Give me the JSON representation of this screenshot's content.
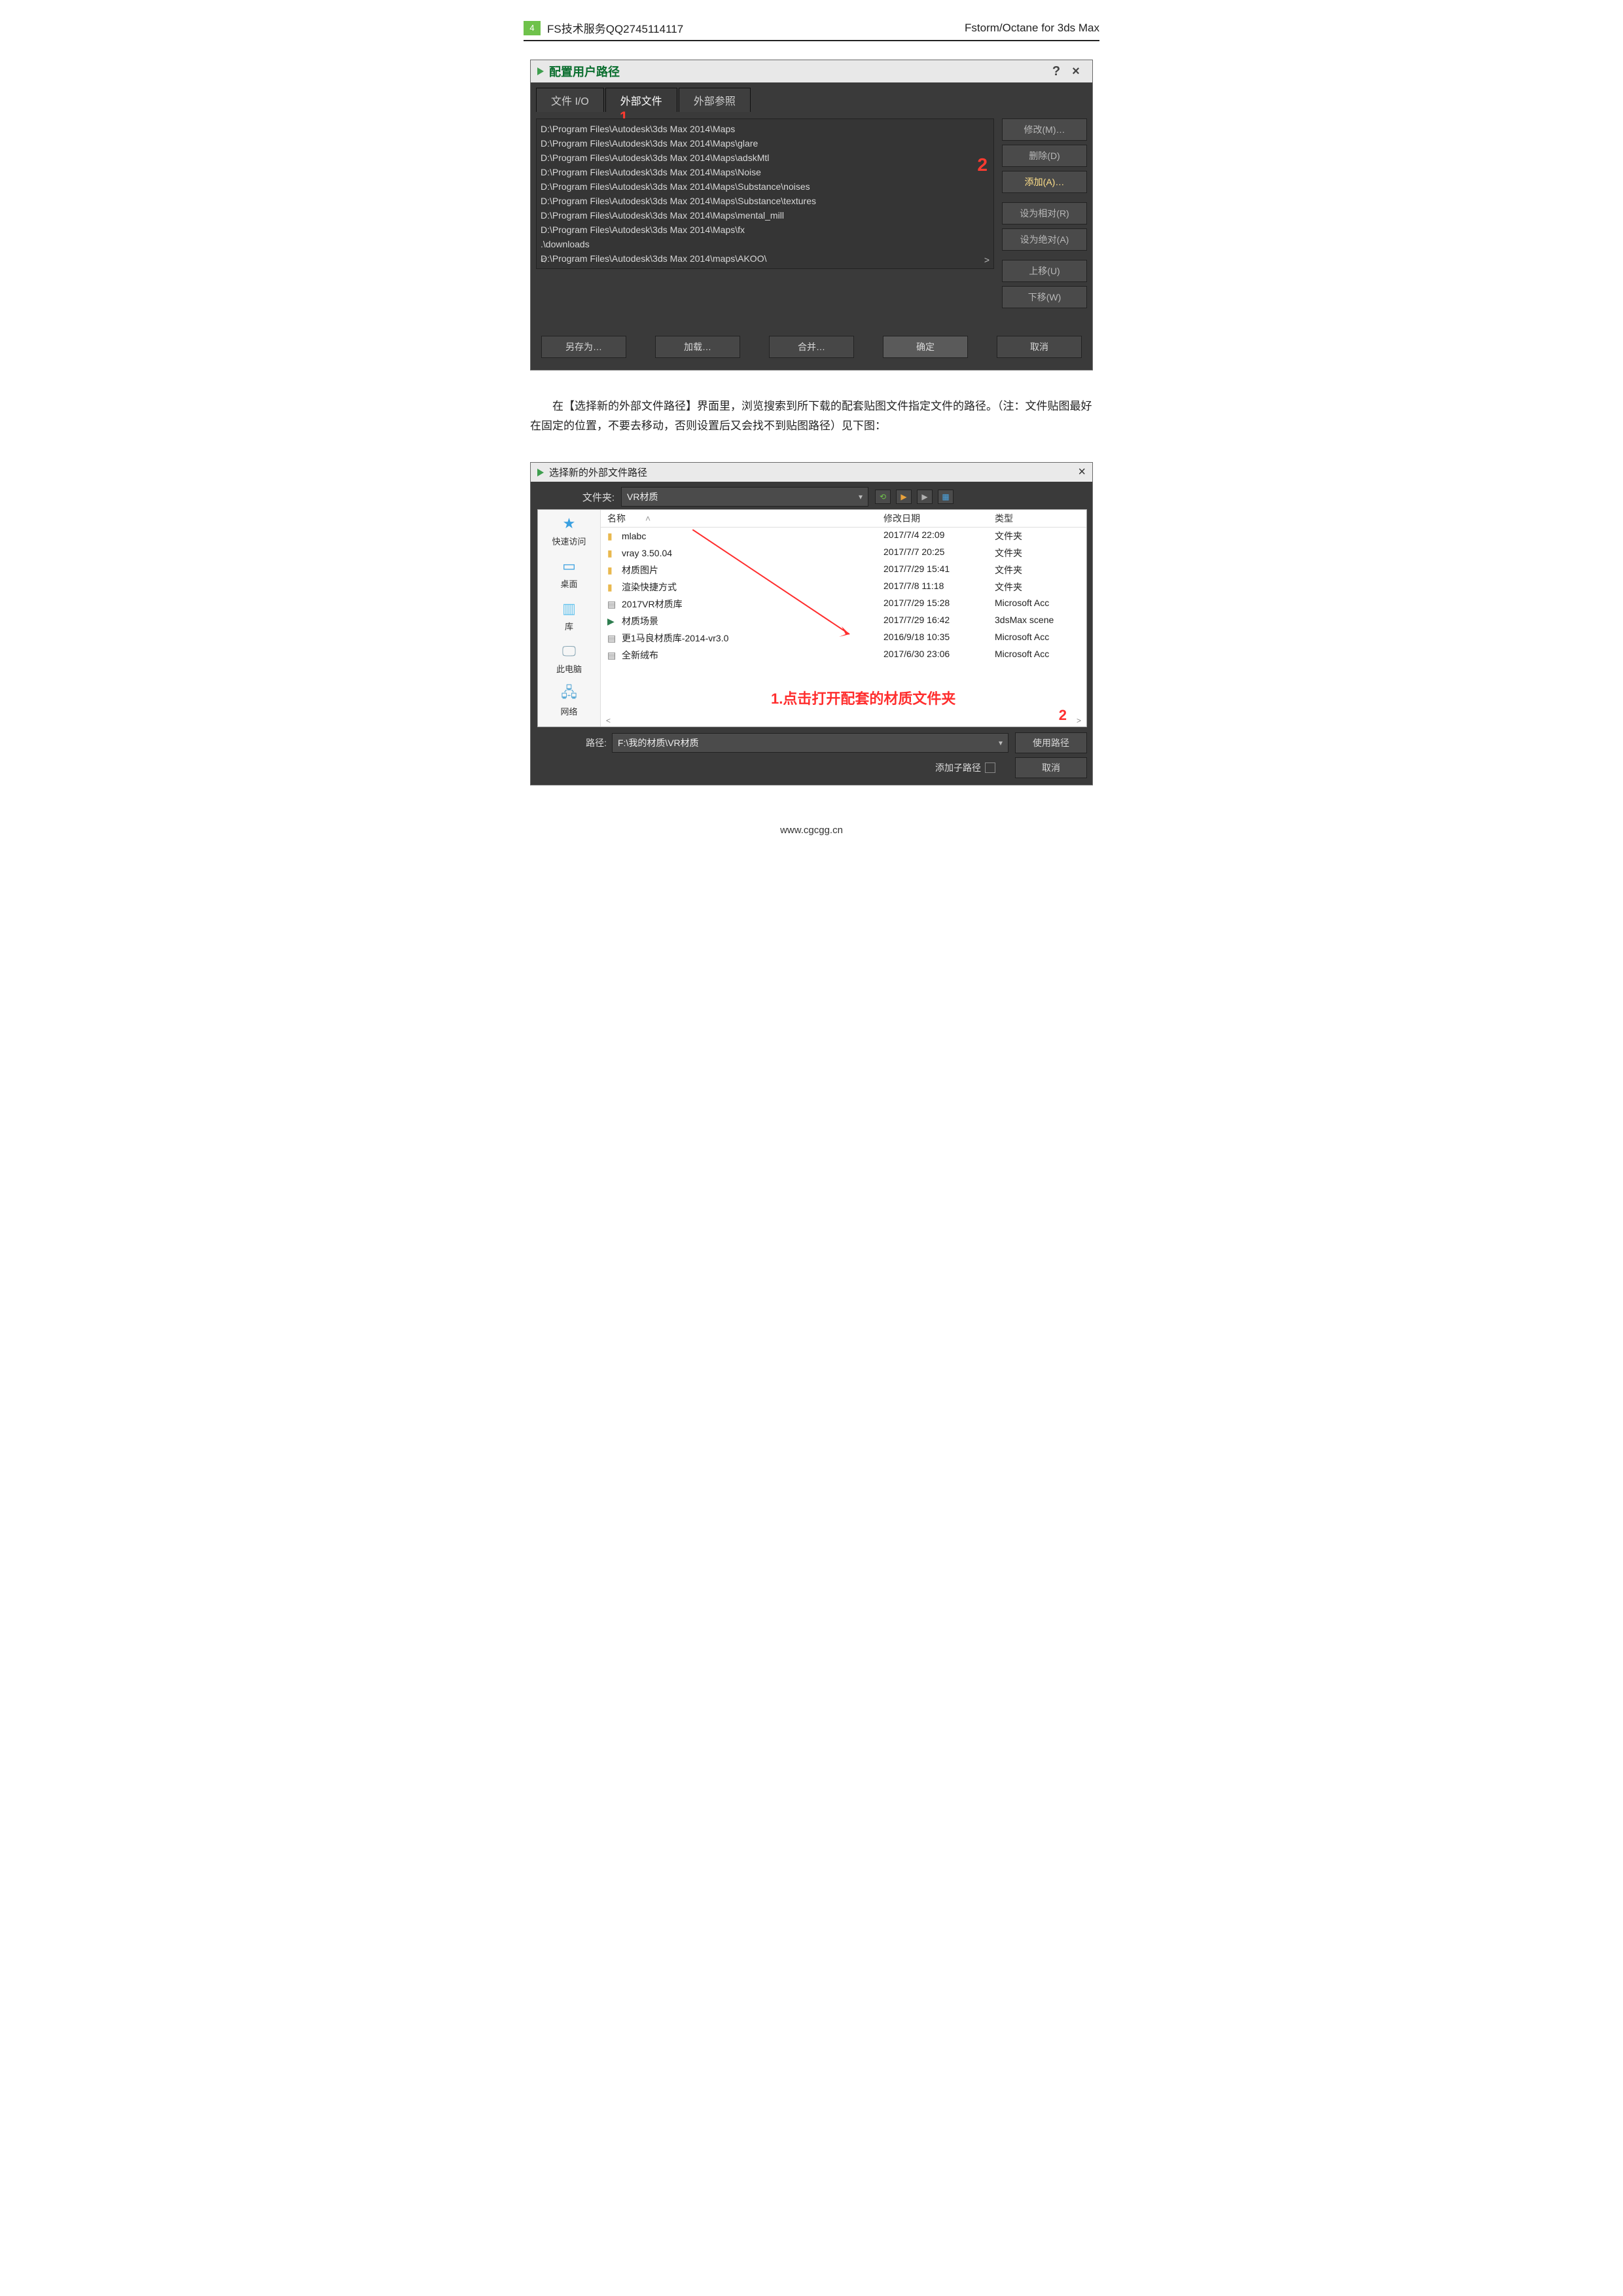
{
  "header": {
    "page_number": "4",
    "left_text": "FS技术服务QQ2745114117",
    "right_text": "Fstorm/Octane for 3ds Max"
  },
  "dialog1": {
    "title": "配置用户路径",
    "help": "?",
    "close": "×",
    "tabs": {
      "file_io": "文件 I/O",
      "external_files": "外部文件",
      "external_ref": "外部参照"
    },
    "paths": [
      "D:\\Program Files\\Autodesk\\3ds Max 2014\\Maps",
      "D:\\Program Files\\Autodesk\\3ds Max 2014\\Maps\\glare",
      "D:\\Program Files\\Autodesk\\3ds Max 2014\\Maps\\adskMtl",
      "D:\\Program Files\\Autodesk\\3ds Max 2014\\Maps\\Noise",
      "D:\\Program Files\\Autodesk\\3ds Max 2014\\Maps\\Substance\\noises",
      "D:\\Program Files\\Autodesk\\3ds Max 2014\\Maps\\Substance\\textures",
      "D:\\Program Files\\Autodesk\\3ds Max 2014\\Maps\\mental_mill",
      "D:\\Program Files\\Autodesk\\3ds Max 2014\\Maps\\fx",
      ".\\downloads",
      "D:\\Program Files\\Autodesk\\3ds Max 2014\\maps\\AKOO\\"
    ],
    "buttons": {
      "modify": "修改(M)…",
      "delete": "删除(D)",
      "add": "添加(A)…",
      "relative": "设为相对(R)",
      "absolute": "设为绝对(A)",
      "up": "上移(U)",
      "down": "下移(W)"
    },
    "bottom": {
      "save_as": "另存为…",
      "load": "加载…",
      "merge": "合并…",
      "ok": "确定",
      "cancel": "取消"
    },
    "annot": {
      "one": "1",
      "two": "2"
    }
  },
  "paragraph": "在【选择新的外部文件路径】界面里，浏览搜索到所下载的配套贴图文件指定文件的路径。（注：文件贴图最好在固定的位置，不要去移动，否则设置后又会找不到贴图路径）见下图：",
  "dialog2": {
    "title": "选择新的外部文件路径",
    "close": "×",
    "folder_label": "文件夹:",
    "folder_value": "VR材质",
    "columns": {
      "name": "名称",
      "date": "修改日期",
      "type": "类型"
    },
    "rows": [
      {
        "icon": "folder",
        "name": "mlabc",
        "date": "2017/7/4 22:09",
        "type": "文件夹",
        "selected": true
      },
      {
        "icon": "folder",
        "name": "vray 3.50.04",
        "date": "2017/7/7 20:25",
        "type": "文件夹"
      },
      {
        "icon": "folder",
        "name": "材质图片",
        "date": "2017/7/29 15:41",
        "type": "文件夹"
      },
      {
        "icon": "folder",
        "name": "渲染快捷方式",
        "date": "2017/7/8 11:18",
        "type": "文件夹"
      },
      {
        "icon": "db",
        "name": "2017VR材质库",
        "date": "2017/7/29 15:28",
        "type": "Microsoft Acc"
      },
      {
        "icon": "max",
        "name": "材质场景",
        "date": "2017/7/29 16:42",
        "type": "3dsMax scene"
      },
      {
        "icon": "db",
        "name": "更1马良材质库-2014-vr3.0",
        "date": "2016/9/18 10:35",
        "type": "Microsoft Acc"
      },
      {
        "icon": "db",
        "name": "全新绒布",
        "date": "2017/6/30 23:06",
        "type": "Microsoft Acc"
      }
    ],
    "sidebar": {
      "quick": "快速访问",
      "desktop": "桌面",
      "library": "库",
      "pc": "此电脑",
      "network": "网络"
    },
    "path_label": "路径:",
    "path_value": "F:\\我的材质\\VR材质",
    "use_path": "使用路径",
    "sub_label": "添加子路径",
    "cancel": "取消",
    "annot": {
      "text1": "1.点击打开配套的材质文件夹",
      "num2": "2"
    }
  },
  "footer": "www.cgcgg.cn"
}
